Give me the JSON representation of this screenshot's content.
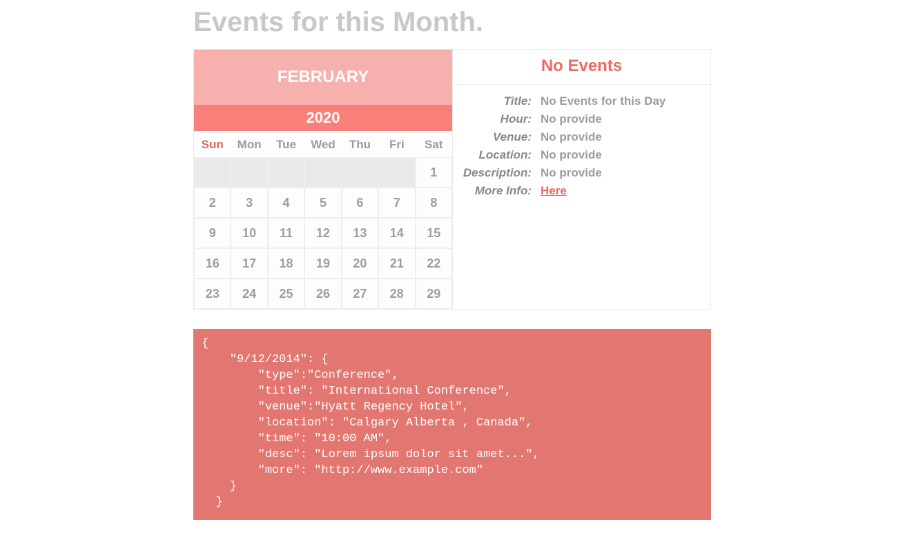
{
  "header": {
    "title": "Events for this Month."
  },
  "calendar": {
    "month": "FEBRUARY",
    "year": "2020",
    "days_of_week": [
      "Sun",
      "Mon",
      "Tue",
      "Wed",
      "Thu",
      "Fri",
      "Sat"
    ],
    "weeks": [
      [
        "",
        "",
        "",
        "",
        "",
        "",
        "1"
      ],
      [
        "2",
        "3",
        "4",
        "5",
        "6",
        "7",
        "8"
      ],
      [
        "9",
        "10",
        "11",
        "12",
        "13",
        "14",
        "15"
      ],
      [
        "16",
        "17",
        "18",
        "19",
        "20",
        "21",
        "22"
      ],
      [
        "23",
        "24",
        "25",
        "26",
        "27",
        "28",
        "29"
      ]
    ]
  },
  "events_panel": {
    "heading": "No Events",
    "labels": {
      "title": "Title:",
      "hour": "Hour:",
      "venue": "Venue:",
      "location": "Location:",
      "description": "Description:",
      "more_info": "More Info:"
    },
    "values": {
      "title": "No Events for this Day",
      "hour": "No provide",
      "venue": "No provide",
      "location": "No provide",
      "description": "No provide",
      "more_info_link_text": "Here"
    }
  },
  "code_block": "{\n    \"9/12/2014\": {\n        \"type\":\"Conference\",\n        \"title\": \"International Conference\",\n        \"venue\":\"Hyatt Regency Hotel\",\n        \"location\": \"Calgary Alberta , Canada\",\n        \"time\": \"10:00 AM\",\n        \"desc\": \"Lorem ipsum dolor sit amet...\",\n        \"more\": \"http://www.example.com\"\n    }\n  }"
}
